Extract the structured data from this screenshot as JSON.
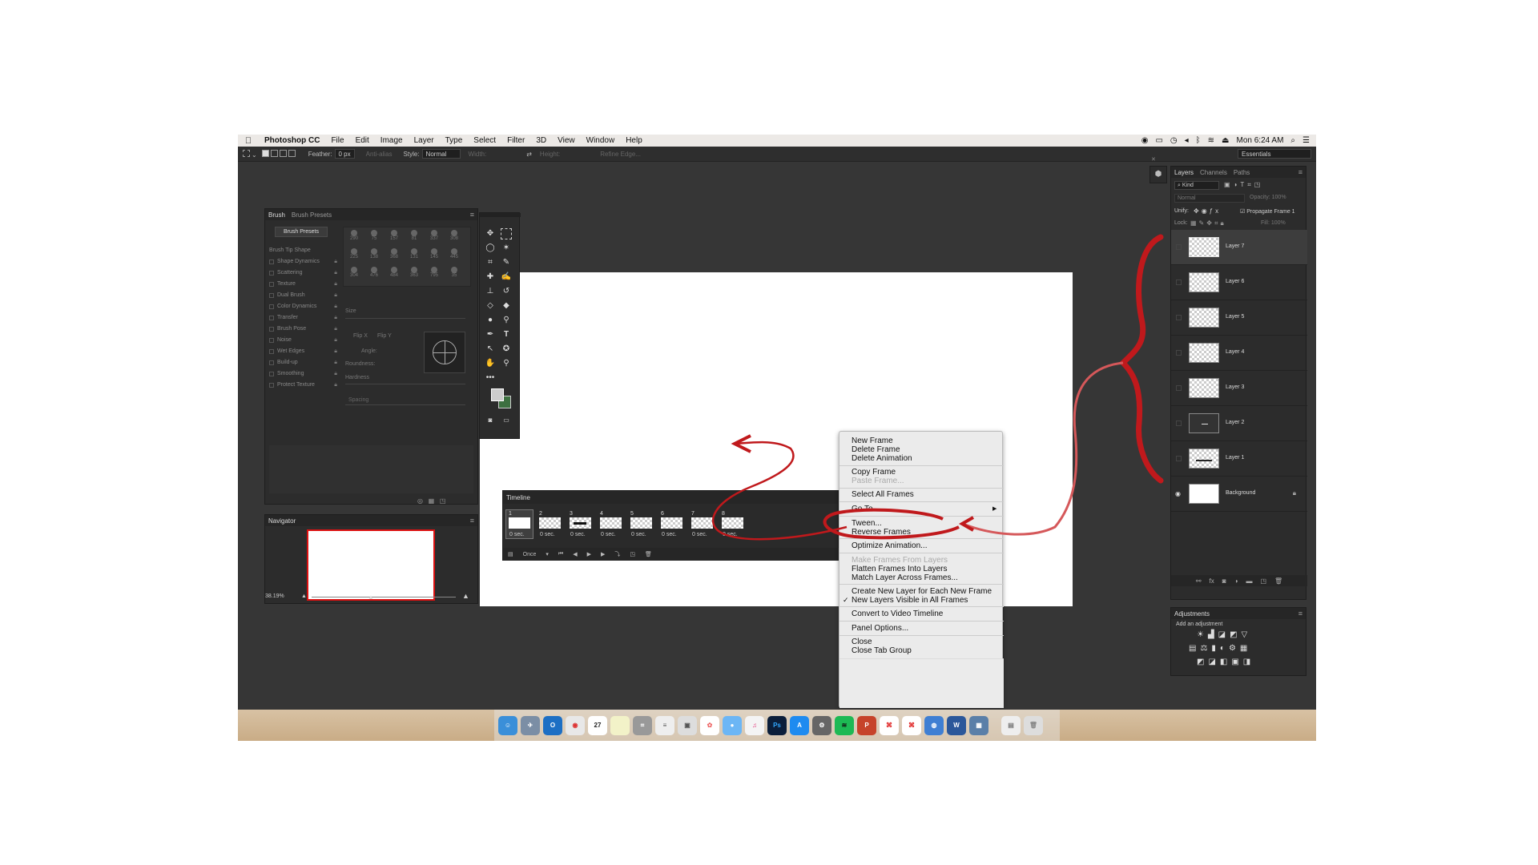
{
  "menubar": {
    "app": "Photoshop CC",
    "items": [
      "File",
      "Edit",
      "Image",
      "Layer",
      "Type",
      "Select",
      "Filter",
      "3D",
      "View",
      "Window",
      "Help"
    ],
    "clock": "Mon 6:24 AM"
  },
  "optionsbar": {
    "feather_label": "Feather:",
    "feather_value": "0 px",
    "antialias": "Anti-alias",
    "style_label": "Style:",
    "style_value": "Normal",
    "width_label": "Width:",
    "height_label": "Height:",
    "refine": "Refine Edge...",
    "workspace": "Essentials"
  },
  "brush_panel": {
    "tabs": [
      "Brush",
      "Brush Presets"
    ],
    "presets_button": "Brush Presets",
    "options": [
      "Brush Tip Shape",
      "Shape Dynamics",
      "Scattering",
      "Texture",
      "Dual Brush",
      "Color Dynamics",
      "Transfer",
      "Brush Pose",
      "Noise",
      "Wet Edges",
      "Build-up",
      "Smoothing",
      "Protect Texture"
    ],
    "tip_sizes": [
      "290",
      "75",
      "157",
      "81",
      "337",
      "308",
      "225",
      "138",
      "368",
      "131",
      "145",
      "445",
      "304",
      "476",
      "484",
      "363",
      "795",
      "35"
    ],
    "size_label": "Size",
    "flipx": "Flip X",
    "flipy": "Flip Y",
    "angle": "Angle:",
    "roundness": "Roundness:",
    "hardness": "Hardness",
    "spacing": "Spacing"
  },
  "navigator": {
    "title": "Navigator",
    "zoom": "38.19%"
  },
  "timeline": {
    "title": "Timeline",
    "frames": [
      {
        "num": "1",
        "delay": "0 sec."
      },
      {
        "num": "2",
        "delay": "0 sec."
      },
      {
        "num": "3",
        "delay": "0 sec."
      },
      {
        "num": "4",
        "delay": "0 sec."
      },
      {
        "num": "5",
        "delay": "0 sec."
      },
      {
        "num": "6",
        "delay": "0 sec."
      },
      {
        "num": "7",
        "delay": "0 sec."
      },
      {
        "num": "8",
        "delay": "0 sec."
      }
    ],
    "loop": "Once"
  },
  "context_menu": {
    "items": [
      "New Frame",
      "Delete Frame",
      "Delete Animation",
      "Copy Frame",
      "Paste Frame...",
      "Select All Frames",
      "Go To",
      "Tween...",
      "Reverse Frames",
      "Optimize Animation...",
      "Make Frames From Layers",
      "Flatten Frames Into Layers",
      "Match Layer Across Frames...",
      "Create New Layer for Each New Frame",
      "New Layers Visible in All Frames",
      "Convert to Video Timeline",
      "Panel Options...",
      "Close",
      "Close Tab Group"
    ],
    "checkmark": "✓",
    "submenu_arrow": "▶"
  },
  "layers_panel": {
    "tabs": [
      "Layers",
      "Channels",
      "Paths"
    ],
    "kind": "Kind",
    "blend_mode": "Normal",
    "opacity_label": "Opacity:",
    "opacity_value": "100%",
    "unify_label": "Unify:",
    "propagate": "Propagate Frame 1",
    "lock_label": "Lock:",
    "fill_label": "Fill:",
    "fill_value": "100%",
    "layers": [
      "Layer 7",
      "Layer 6",
      "Layer 5",
      "Layer 4",
      "Layer 3",
      "Layer 2",
      "Layer 1",
      "Background"
    ]
  },
  "adjustments": {
    "title": "Adjustments",
    "subtitle": "Add an adjustment"
  },
  "dock": {
    "calendar_day": "27",
    "ps": "Ps",
    "word": "W"
  },
  "colors": {
    "annotation": "#c0191c",
    "background": "#363636",
    "menu_bg": "#ebebeb"
  }
}
